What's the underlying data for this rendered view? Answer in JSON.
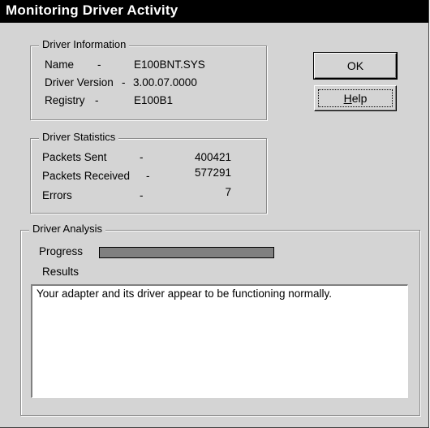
{
  "window": {
    "title": "Monitoring Driver Activity"
  },
  "driver_info": {
    "legend": "Driver Information",
    "rows": [
      {
        "label": "Name",
        "sep": "-",
        "value": "E100BNT.SYS"
      },
      {
        "label": "Driver Version",
        "sep": "-",
        "value": "3.00.07.0000"
      },
      {
        "label": "Registry",
        "sep": "-",
        "value": "E100B1"
      }
    ]
  },
  "driver_stats": {
    "legend": "Driver Statistics",
    "rows": [
      {
        "label": "Packets Sent",
        "sep": "-",
        "value": "400421"
      },
      {
        "label": "Packets Received",
        "sep": "-",
        "value": "577291"
      },
      {
        "label": "Errors",
        "sep": "-",
        "value": "7"
      }
    ]
  },
  "analysis": {
    "legend": "Driver Analysis",
    "progress_label": "Progress",
    "progress_value": 1.0,
    "results_label": "Results",
    "results_text": "Your adapter and its driver appear to be functioning normally."
  },
  "buttons": {
    "ok": "OK",
    "help_prefix": "",
    "help_mnemonic": "H",
    "help_rest": "elp"
  },
  "colors": {
    "title_bg": "#000000",
    "dialog_bg": "#d4d4d4",
    "progress_fill": "#808080"
  }
}
